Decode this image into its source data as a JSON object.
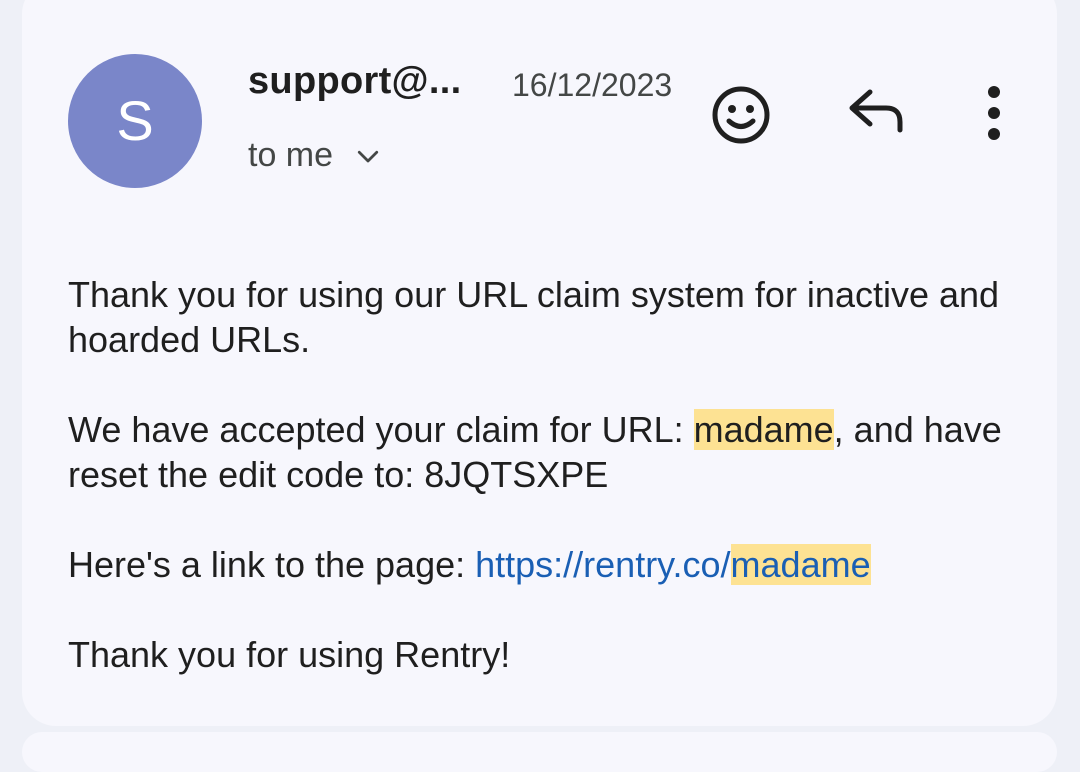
{
  "email": {
    "sender": {
      "initial": "S",
      "name": "support@...",
      "avatar_color": "#7a86c9"
    },
    "date": "16/12/2023",
    "recipient_label": "to me",
    "actions": {
      "emoji_icon": "smiley-face-icon",
      "reply_icon": "reply-arrow-icon",
      "more_icon": "more-vertical-icon",
      "expand_icon": "chevron-down-icon"
    },
    "body": {
      "p1": "Thank you for using our URL claim system for inactive and hoarded URLs.",
      "p2_before": "We have accepted your claim for URL: ",
      "p2_highlight": "madame",
      "p2_after": ", and have reset the edit code to: 8JQTSXPE",
      "p3_before": "Here's a link to the page: ",
      "p3_link_prefix": "https://rentry.co/",
      "p3_link_highlight": "madame",
      "p4": "Thank you for using Rentry!"
    },
    "colors": {
      "highlight": "#fde293",
      "link": "#1a5fb4",
      "card_background": "#f7f7fd"
    }
  }
}
